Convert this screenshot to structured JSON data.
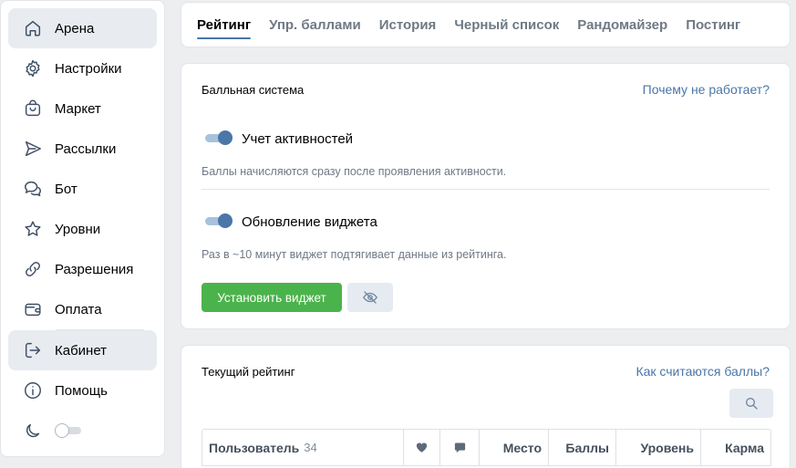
{
  "sidebar": {
    "items": [
      {
        "label": "Арена",
        "icon": "home-icon",
        "active": true
      },
      {
        "label": "Настройки",
        "icon": "gear-icon",
        "active": false
      },
      {
        "label": "Маркет",
        "icon": "shopping-bag-icon",
        "active": false
      },
      {
        "label": "Рассылки",
        "icon": "send-icon",
        "active": false
      },
      {
        "label": "Бот",
        "icon": "chat-bubbles-icon",
        "active": false
      },
      {
        "label": "Уровни",
        "icon": "star-icon",
        "active": false
      },
      {
        "label": "Разрешения",
        "icon": "link-icon",
        "active": false
      },
      {
        "label": "Оплата",
        "icon": "wallet-icon",
        "active": false
      },
      {
        "label": "Кабинет",
        "icon": "logout-icon",
        "active": true
      },
      {
        "label": "Помощь",
        "icon": "info-icon",
        "active": false
      }
    ],
    "theme_icon": "moon-icon",
    "theme_toggle_on": false
  },
  "tabs": [
    {
      "label": "Рейтинг",
      "active": true
    },
    {
      "label": "Упр. баллами",
      "active": false
    },
    {
      "label": "История",
      "active": false
    },
    {
      "label": "Черный список",
      "active": false
    },
    {
      "label": "Рандомайзер",
      "active": false
    },
    {
      "label": "Постинг",
      "active": false
    }
  ],
  "points_card": {
    "title": "Балльная система",
    "help_link": "Почему не работает?",
    "activity_toggle": {
      "label": "Учет активностей",
      "on": true,
      "hint": "Баллы начисляются сразу после проявления активности."
    },
    "widget_toggle": {
      "label": "Обновление виджета",
      "on": true,
      "hint": "Раз в ~10 минут виджет подтягивает данные из рейтинга."
    },
    "install_button": "Установить виджет",
    "hide_icon": "eye-off-icon"
  },
  "rating_card": {
    "title": "Текущий рейтинг",
    "help_link": "Как считаются баллы?",
    "search_icon": "search-icon",
    "columns": {
      "user": "Пользователь",
      "user_count": "34",
      "likes_icon": "heart-icon",
      "comments_icon": "comment-icon",
      "place": "Место",
      "points": "Баллы",
      "level": "Уровень",
      "karma": "Карма"
    }
  },
  "colors": {
    "accent": "#4a76a8",
    "green": "#4bb34b",
    "background": "#edeef0"
  }
}
